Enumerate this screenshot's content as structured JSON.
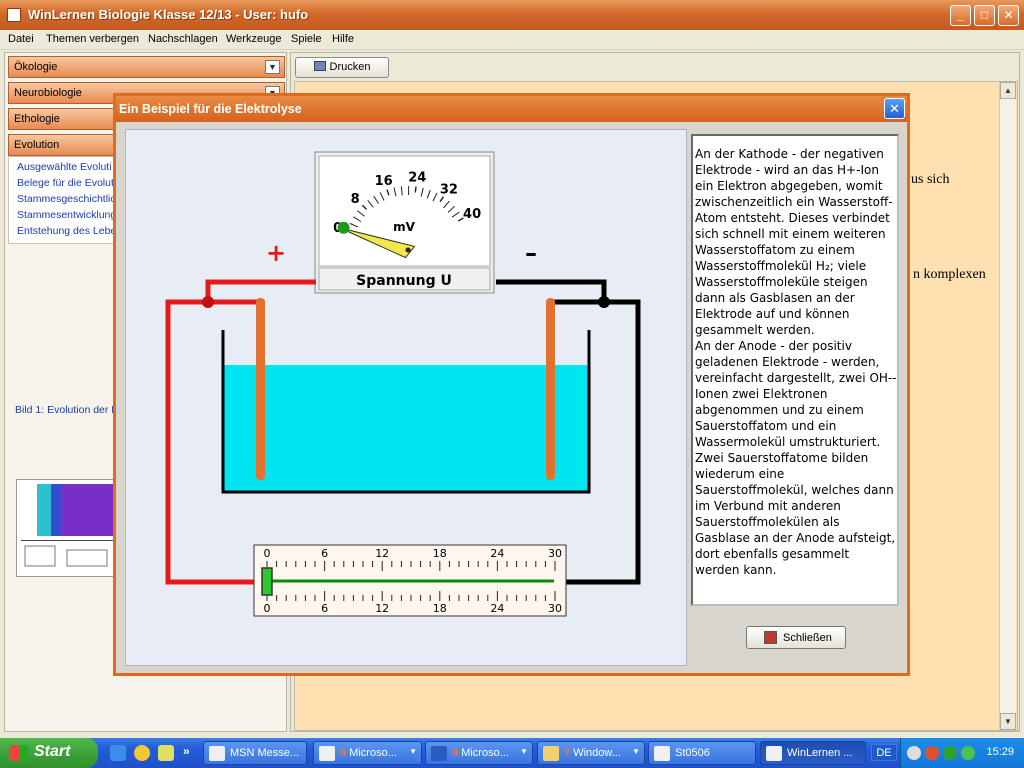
{
  "window": {
    "title": "WinLernen Biologie Klasse 12/13 - User: hufo"
  },
  "window_controls": {
    "minimize": "_",
    "maximize": "□",
    "close": "✕"
  },
  "menu": [
    "Datei",
    "Themen verbergen",
    "Nachschlagen",
    "Werkzeuge",
    "Spiele",
    "Hilfe"
  ],
  "sidebar": {
    "sections": [
      "Ökologie",
      "Neurobiologie",
      "Ethologie",
      "Evolution"
    ],
    "evolution_items": [
      "Ausgewählte Evoluti",
      "Belege für die Evolut",
      "Stammesgeschichtlic",
      "Stammesentwicklung",
      "Entstehung des Lebe"
    ],
    "image_caption": "Bild 1: Evolution der E"
  },
  "toolbar": {
    "print_label": "Drucken"
  },
  "content": {
    "fragment_1": "us sich",
    "fragment_2": "n komplexen"
  },
  "dialog": {
    "title": "Ein Beispiel für die Elektrolyse",
    "close_glyph": "✕",
    "close_button_label": "Schließen",
    "paragraph_1": "An der Kathode - der negativen Elektrode - wird an das H+-Ion ein Elektron abgegeben, womit zwischenzeitlich ein Wasserstoff-Atom entsteht. Dieses verbindet sich schnell mit einem weiteren Wasserstoffatom zu einem Wasserstoffmolekül H₂; viele Wasserstoffmoleküle steigen dann als Gasblasen an der Elektrode auf und können gesammelt werden.",
    "paragraph_2": "An der Anode - der positiv geladenen Elektrode - werden, vereinfacht dargestellt, zwei OH--Ionen zwei Elektronen abgenommen und zu einem Sauerstoffatom und ein Wassermolekül umstrukturiert. Zwei Sauerstoffatome bilden wiederum eine Sauerstoffmolekül, welches dann im Verbund mit anderen Sauerstoffmolekülen als Gasblase an der Anode aufsteigt, dort ebenfalls gesammelt werden kann."
  },
  "simulation": {
    "meter": {
      "label": "Spannung U",
      "unit": "mV",
      "scale_labels": [
        "0",
        "8",
        "16",
        "24",
        "32",
        "40"
      ],
      "scale_max": 40,
      "needle_value": 0
    },
    "polarity": {
      "positive": "+",
      "negative": "–"
    },
    "slider": {
      "ticks": [
        "0",
        "6",
        "12",
        "18",
        "24",
        "30"
      ],
      "max": 30,
      "value": 0
    },
    "colors": {
      "positive_wire": "#e51b1b",
      "negative_wire": "#000000",
      "electrolyte": "#00e5ef",
      "electrode": "#e2702e",
      "needle": "#f0e84a"
    }
  },
  "taskbar": {
    "start_label": "Start",
    "quicklaunch_more": "»",
    "tasks": [
      {
        "label": "MSN Messe...",
        "count": "",
        "active": false
      },
      {
        "label": "Microso...",
        "count": "6",
        "active": false
      },
      {
        "label": "Microso...",
        "count": "8",
        "active": false
      },
      {
        "label": "Window...",
        "count": "7",
        "active": false
      },
      {
        "label": "St0506",
        "count": "",
        "active": false
      },
      {
        "label": "WinLernen ...",
        "count": "",
        "active": true
      }
    ],
    "language": "DE",
    "clock": "15:29"
  }
}
